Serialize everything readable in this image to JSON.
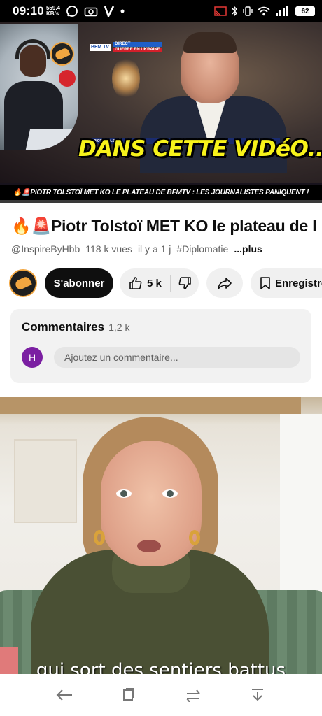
{
  "status_bar": {
    "time": "09:10",
    "net_speed_value": "559.4",
    "net_speed_unit": "KB/s",
    "battery": "62",
    "icons": [
      "whatsapp-icon",
      "camera-icon",
      "v-app-icon",
      "dot-icon",
      "cast-icon",
      "bluetooth-icon",
      "vibrate-icon",
      "wifi-icon",
      "signal-icon",
      "battery-icon"
    ]
  },
  "player": {
    "network_tag": "BFM TV",
    "live_tag": "DIRECT",
    "topic_tag": "GUERRE EN UKRAINE",
    "lower_third": "PIOTR TOLSTOÏ",
    "banner": "DANS CETTE VIDéO...",
    "caption": "🔥🚨PIOTR TOLSTOÏ MET KO LE PLATEAU DE BFMTV : LES JOURNALISTES PANIQUENT !",
    "progress_fraction": 0.0
  },
  "video": {
    "title": "🔥🚨Piotr Tolstoï MET KO le plateau de BFMTV",
    "channel_handle": "@InspireByHbb",
    "views": "118 k vues",
    "age": "il y a 1 j",
    "hashtag": "#Diplomatie",
    "more_label": "...plus"
  },
  "actions": {
    "subscribe_label": "S'abonner",
    "like_count": "5 k",
    "save_label": "Enregistrer"
  },
  "comments": {
    "heading": "Commentaires",
    "count": "1,2 k",
    "user_initial": "H",
    "placeholder": "Ajoutez un commentaire..."
  },
  "next_short": {
    "subtitle": "qui sort des sentiers battus"
  },
  "colors": {
    "accent_red": "#ff0000",
    "banner_yellow": "#f7f21a",
    "avatar_purple": "#7b1fa2",
    "channel_orange": "#f2a640"
  }
}
